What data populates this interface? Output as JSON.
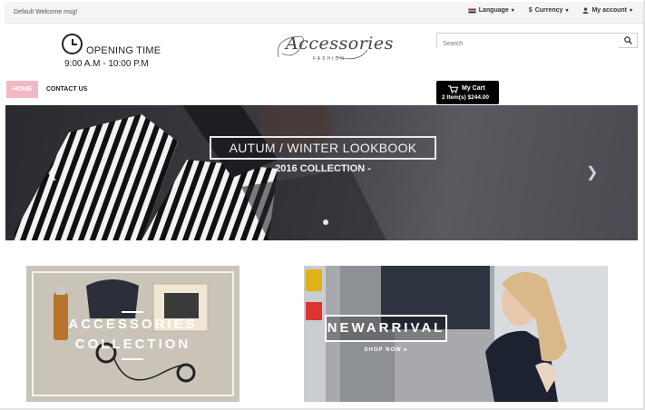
{
  "topbar": {
    "welcome": "Default Welcome msg!",
    "language": "Language",
    "currency": "Currency",
    "account": "My account"
  },
  "header": {
    "opening_label": "OPENING TIME",
    "opening_hours": "9:00 A.M - 10:00 P.M",
    "logo_script": "Accessories",
    "logo_sub": "FASHION",
    "search_placeholder": "Search"
  },
  "nav": {
    "home": "HOME",
    "contact": "CONTACT US"
  },
  "cart": {
    "title": "My Cart",
    "summary": "2 Item(s) $244.00"
  },
  "slider": {
    "title": "AUTUM / WINTER LOOKBOOK",
    "subtitle": "2016 COLLECTION -",
    "prev_icon": "chevron-left-icon",
    "next_icon": "chevron-right-icon"
  },
  "banners": {
    "left_line1": "ACCESSORIES",
    "left_line2": "COLLECTION",
    "right_title": "NEWARRIVAL",
    "shop_now": "SHOP NOW ▸"
  },
  "colors": {
    "home_bg": "#f2b8c4",
    "cart_bg": "#000000",
    "topbar_bg": "#f4f4f4"
  }
}
